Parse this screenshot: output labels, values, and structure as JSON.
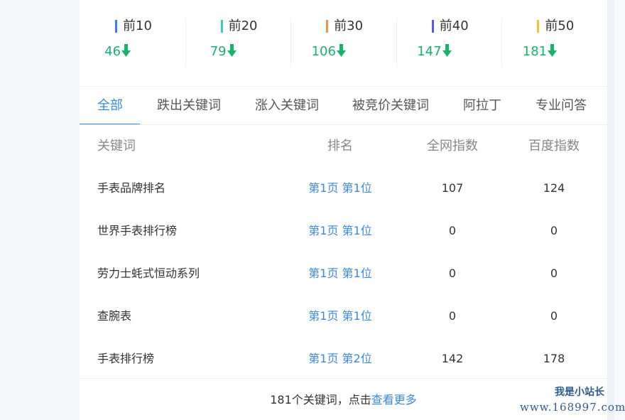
{
  "rank_stats": [
    {
      "label": "前10",
      "value": "46",
      "bar_color": "#3d7cf2"
    },
    {
      "label": "前20",
      "value": "79",
      "bar_color": "#3ccfb0"
    },
    {
      "label": "前30",
      "value": "106",
      "bar_color": "#f0924a"
    },
    {
      "label": "前40",
      "value": "147",
      "bar_color": "#5a57e8"
    },
    {
      "label": "前50",
      "value": "181",
      "bar_color": "#f4c430"
    }
  ],
  "trend_icon": "arrow-down-icon",
  "trend_color": "#18b36b",
  "tabs": [
    {
      "label": "全部",
      "active": true
    },
    {
      "label": "跌出关键词",
      "active": false
    },
    {
      "label": "涨入关键词",
      "active": false
    },
    {
      "label": "被竞价关键词",
      "active": false
    },
    {
      "label": "阿拉丁",
      "active": false
    },
    {
      "label": "专业问答",
      "active": false
    }
  ],
  "table": {
    "headers": [
      "关键词",
      "排名",
      "全网指数",
      "百度指数"
    ],
    "rows": [
      {
        "keyword": "手表品牌排名",
        "rank": "第1页 第1位",
        "net_index": "107",
        "baidu_index": "124"
      },
      {
        "keyword": "世界手表排行榜",
        "rank": "第1页 第1位",
        "net_index": "0",
        "baidu_index": "0"
      },
      {
        "keyword": "劳力士蚝式恒动系列",
        "rank": "第1页 第1位",
        "net_index": "0",
        "baidu_index": "0"
      },
      {
        "keyword": "查腕表",
        "rank": "第1页 第1位",
        "net_index": "0",
        "baidu_index": "0"
      },
      {
        "keyword": "手表排行榜",
        "rank": "第1页 第2位",
        "net_index": "142",
        "baidu_index": "178"
      }
    ]
  },
  "footer": {
    "text": "181个关键词，点击",
    "link": "查看更多"
  },
  "watermark": {
    "line1": "我是小站长",
    "line2": "www.168997.com"
  },
  "colors": {
    "accent": "#3b8ad9",
    "trend_down": "#18b36b"
  }
}
